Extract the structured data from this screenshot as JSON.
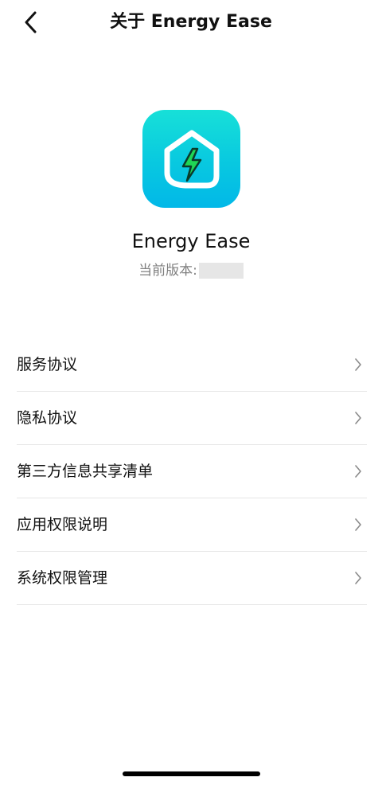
{
  "header": {
    "title": "关于 Energy Ease"
  },
  "app": {
    "name": "Energy Ease",
    "version_label": "当前版本:",
    "version_value": ""
  },
  "menu": {
    "items": [
      {
        "label": "服务协议"
      },
      {
        "label": "隐私协议"
      },
      {
        "label": "第三方信息共享清单"
      },
      {
        "label": "应用权限说明"
      },
      {
        "label": "系统权限管理"
      }
    ]
  },
  "colors": {
    "icon_gradient_top": "#17e0d8",
    "icon_gradient_bottom": "#02b8e8",
    "bolt_green": "#1fd655",
    "divider": "#e6e6e6",
    "secondary_text": "#808080"
  },
  "icons": {
    "back": "chevron-left-icon",
    "app": "house-lightning-icon",
    "row_arrow": "chevron-right-icon"
  }
}
